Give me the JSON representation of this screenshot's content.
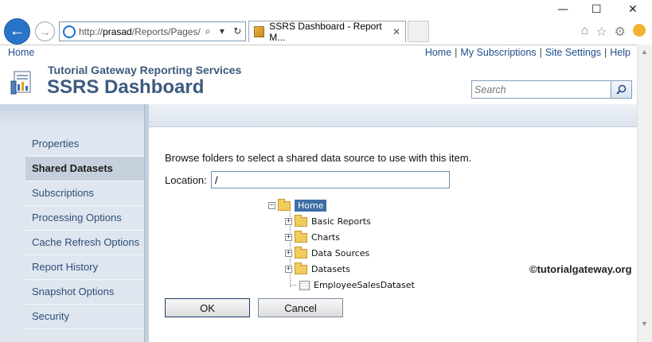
{
  "browser": {
    "window_controls": [
      "—",
      "☐",
      "✕"
    ],
    "address": {
      "scheme": "http://",
      "host": "prasad",
      "path": "/Reports/Pages/",
      "tools": "⌕ ▾ ↻"
    },
    "tab_title": "SSRS Dashboard - Report M...",
    "tab_close": "✕"
  },
  "topbar": {
    "home": "Home",
    "links": [
      "Home",
      "My Subscriptions",
      "Site Settings",
      "Help"
    ],
    "separator": "|"
  },
  "header": {
    "brand": "Tutorial Gateway Reporting Services",
    "title": "SSRS Dashboard",
    "search_placeholder": "Search"
  },
  "sidebar": {
    "items": [
      {
        "label": "Properties",
        "active": false
      },
      {
        "label": "Shared Datasets",
        "active": true
      },
      {
        "label": "Subscriptions",
        "active": false
      },
      {
        "label": "Processing Options",
        "active": false
      },
      {
        "label": "Cache Refresh Options",
        "active": false
      },
      {
        "label": "Report History",
        "active": false
      },
      {
        "label": "Snapshot Options",
        "active": false
      },
      {
        "label": "Security",
        "active": false
      }
    ]
  },
  "main": {
    "instruction": "Browse folders to select a shared data source to use with this item.",
    "location_label": "Location:",
    "location_value": "/",
    "tree": {
      "root": "Home",
      "children": [
        {
          "label": "Basic Reports",
          "type": "folder"
        },
        {
          "label": "Charts",
          "type": "folder"
        },
        {
          "label": "Data Sources",
          "type": "folder"
        },
        {
          "label": "Datasets",
          "type": "folder"
        },
        {
          "label": "EmployeeSalesDataset",
          "type": "dataset"
        }
      ]
    },
    "ok_label": "OK",
    "cancel_label": "Cancel"
  },
  "watermark": "©tutorialgateway.org",
  "colors": {
    "link": "#1f4e8c",
    "title": "#3c5a7e",
    "nav_bg": "#dfe6ef",
    "selected_node": "#3d6ea5"
  }
}
